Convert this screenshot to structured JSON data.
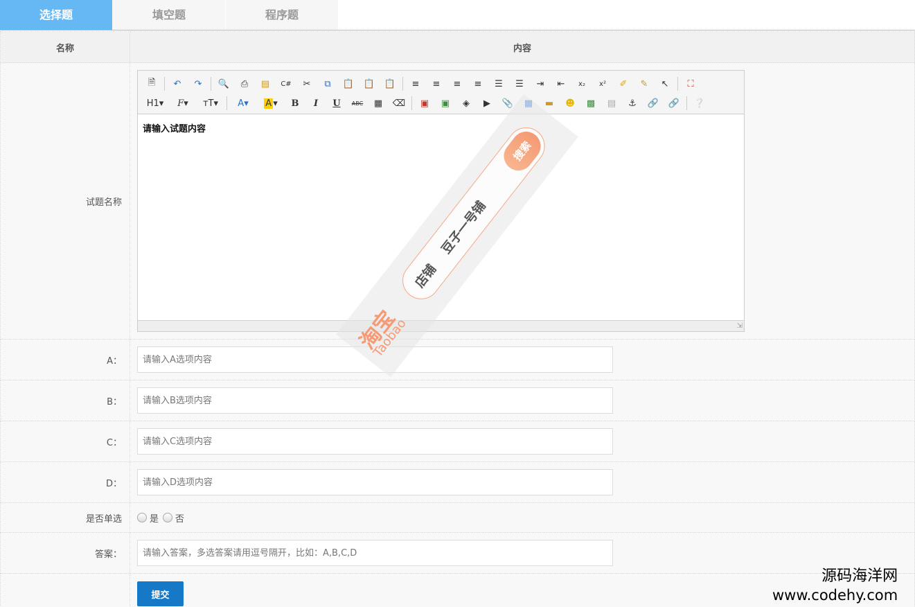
{
  "tabs": [
    {
      "label": "选择题",
      "active": true
    },
    {
      "label": "填空题",
      "active": false
    },
    {
      "label": "程序题",
      "active": false
    }
  ],
  "table": {
    "header_name": "名称",
    "header_content": "内容"
  },
  "editor": {
    "label": "试题名称",
    "content": "请输入试题内容",
    "toolbar_row1": [
      "source-icon",
      "undo-icon",
      "redo-icon",
      "preview-icon",
      "print-icon",
      "template-icon",
      "code-icon",
      "cut-icon",
      "copy-icon",
      "paste-icon",
      "paste-text-icon",
      "paste-word-icon",
      "align-left-icon",
      "align-center-icon",
      "align-right-icon",
      "align-justify-icon",
      "ordered-list-icon",
      "unordered-list-icon",
      "indent-icon",
      "outdent-icon",
      "subscript-icon",
      "superscript-icon",
      "clear-format-icon",
      "select-all-icon",
      "select-icon",
      "fullscreen-icon"
    ],
    "toolbar_row2_text": {
      "heading": "H1",
      "font": "F",
      "size": "тT",
      "forecolor": "A",
      "hilite": "A",
      "bold": "B",
      "italic": "I",
      "underline": "U",
      "strike": "ABC"
    }
  },
  "options": [
    {
      "label": "A：",
      "placeholder": "请输入A选项内容"
    },
    {
      "label": "B：",
      "placeholder": "请输入B选项内容"
    },
    {
      "label": "C：",
      "placeholder": "请输入C选项内容"
    },
    {
      "label": "D：",
      "placeholder": "请输入D选项内容"
    }
  ],
  "single_choice": {
    "label": "是否单选",
    "yes": "是",
    "no": "否"
  },
  "answer": {
    "label": "答案：",
    "placeholder": "请输入答案，多选答案请用逗号隔开，比如：A,B,C,D"
  },
  "submit_label": "提交",
  "watermark": {
    "site_name": "源码海洋网",
    "site_url": "www.codehy.com"
  },
  "stamp": {
    "brand": "淘宝",
    "brand_en": "Taobao",
    "shop": "店铺",
    "shop_name": "豆子一号铺",
    "search": "搜索"
  },
  "colors": {
    "tab_active": "#66b8f5",
    "submit": "#1579c8",
    "stamp_accent": "#f59a74"
  }
}
